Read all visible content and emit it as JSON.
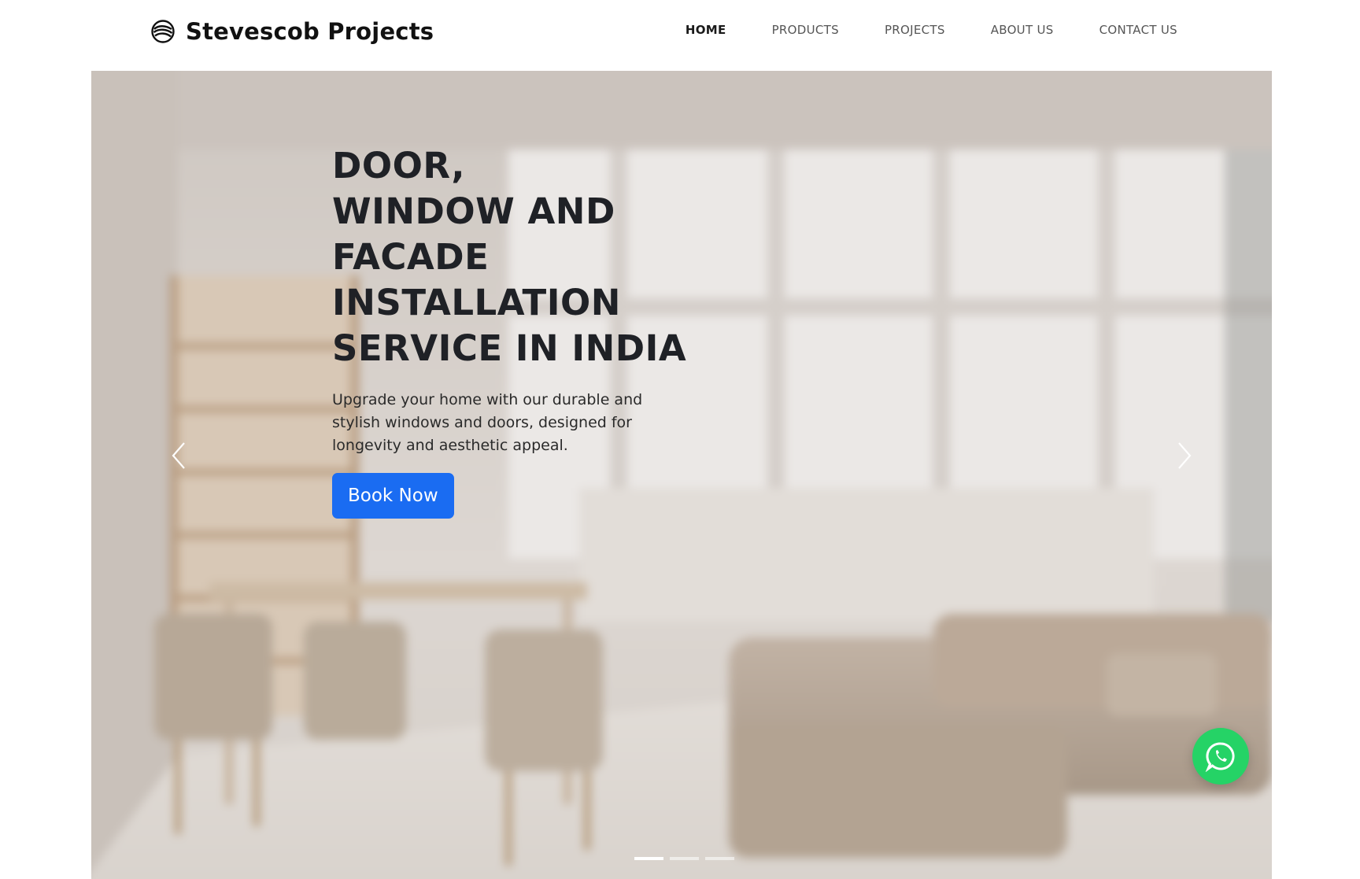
{
  "header": {
    "brand_name": "Stevescob Projects",
    "brand_icon": "swirl-logo-icon",
    "nav": [
      {
        "label": "HOME",
        "active": true
      },
      {
        "label": "PRODUCTS",
        "active": false
      },
      {
        "label": "PROJECTS",
        "active": false
      },
      {
        "label": "ABOUT US",
        "active": false
      },
      {
        "label": "CONTACT US",
        "active": false
      }
    ]
  },
  "hero": {
    "title": "DOOR,\nWINDOW AND\nFACADE\nINSTALLATION\nSERVICE IN INDIA",
    "subtitle": "Upgrade your home with our durable and stylish windows and doors, designed for longevity and aesthetic appeal.",
    "cta_label": "Book Now",
    "prev_icon": "chevron-left-icon",
    "next_icon": "chevron-right-icon",
    "slides_total": 3,
    "active_slide": 1
  },
  "floating": {
    "whatsapp_icon": "whatsapp-icon"
  },
  "colors": {
    "primary_button": "#1a6cf2",
    "whatsapp": "#25d366",
    "title_text": "#1f2126",
    "nav_active": "#1a1a1a",
    "nav_inactive": "#555555"
  }
}
